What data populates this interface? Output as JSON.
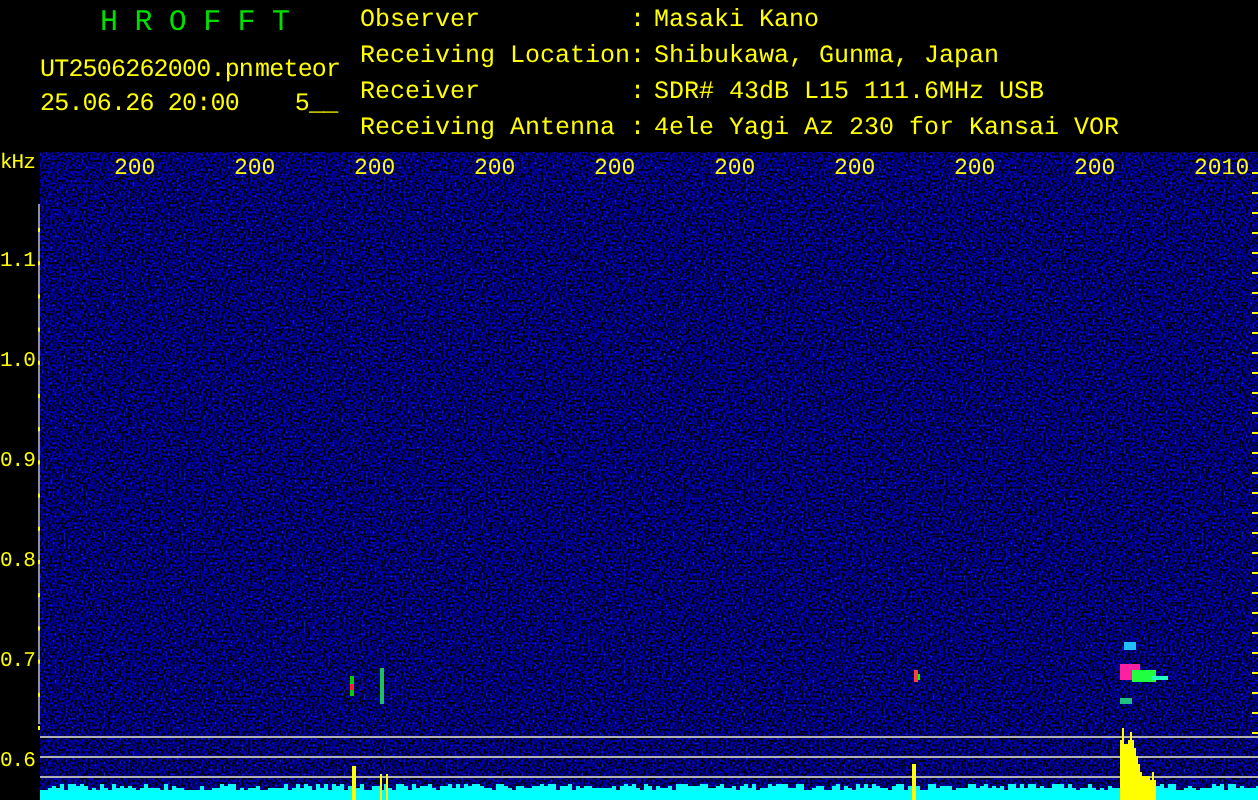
{
  "app_title": "H R O F F T",
  "file_name": "UT2506262000.pn",
  "event_label": "meteor",
  "timestamp": "25.06.26 20:00",
  "count": "5__",
  "info": {
    "separator": ":",
    "rows": [
      {
        "label": "Observer",
        "value": "Masaki Kano"
      },
      {
        "label": "Receiving Location",
        "value": "Shibukawa, Gunma, Japan"
      },
      {
        "label": "Receiver",
        "value": "SDR# 43dB L15 111.6MHz USB"
      },
      {
        "label": "Receiving Antenna",
        "value": "4ele Yagi Az 230 for Kansai VOR"
      }
    ]
  },
  "freq_unit": "kHz",
  "freq_labels": [
    "1.1",
    "1.0",
    "0.9",
    "0.8",
    "0.7",
    "0.6"
  ],
  "time_labels": [
    "200",
    "200",
    "200",
    "200",
    "200",
    "200",
    "200",
    "200",
    "200",
    "2010"
  ]
}
